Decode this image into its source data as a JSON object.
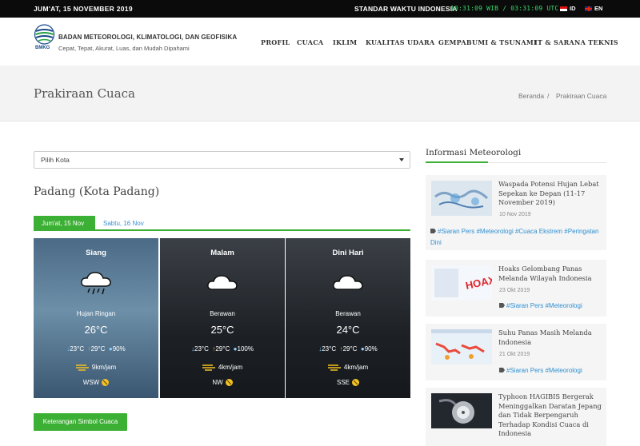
{
  "topbar": {
    "date": "JUM'AT, 15 NOVEMBER 2019",
    "standard_time_label": "STANDAR WAKTU INDONESIA",
    "clock": "10:31:09 WIB / 03:31:09 UTC",
    "lang_id": "ID",
    "lang_en": "EN"
  },
  "header": {
    "logo_text": "BMKG",
    "org_name": "BADAN METEOROLOGI, KLIMATOLOGI, DAN GEOFISIKA",
    "tagline": "Cepat, Tepat, Akurat, Luas, dan Mudah Dipahami",
    "nav": [
      "PROFIL",
      "CUACA",
      "IKLIM",
      "KUALITAS UDARA",
      "GEMPABUMI & TSUNAMI",
      "IT & SARANA TEKNIS"
    ]
  },
  "band": {
    "title": "Prakiraan Cuaca",
    "breadcrumb_home": "Beranda",
    "breadcrumb_sep": "/",
    "breadcrumb_current": "Prakiraan Cuaca"
  },
  "forecast": {
    "select_placeholder": "Pilih Kota",
    "city": "Padang (Kota Padang)",
    "tabs": [
      "Jum'at, 15 Nov",
      "Sabtu, 16 Nov"
    ],
    "cards": [
      {
        "period": "Siang",
        "weather": "Hujan Ringan",
        "temp": "26°C",
        "tmin": "23°C",
        "tmax": "29°C",
        "humidity": "90%",
        "wind_speed": "9km/jam",
        "wind_dir": "WSW"
      },
      {
        "period": "Malam",
        "weather": "Berawan",
        "temp": "25°C",
        "tmin": "23°C",
        "tmax": "29°C",
        "humidity": "100%",
        "wind_speed": "4km/jam",
        "wind_dir": "NW"
      },
      {
        "period": "Dini Hari",
        "weather": "Berawan",
        "temp": "24°C",
        "tmin": "23°C",
        "tmax": "29°C",
        "humidity": "90%",
        "wind_speed": "4km/jam",
        "wind_dir": "SSE"
      }
    ],
    "legend_button": "Keterangan Simbol Cuaca"
  },
  "sidebar": {
    "title": "Informasi Meteorologi",
    "news": [
      {
        "title": "Waspada Potensi Hujan Lebat Sepekan ke Depan (11-17 November 2019)",
        "date": "10 Nov 2019",
        "tags": "#Siaran Pers #Meteorologi #Cuaca Ekstrem #Peringatan Dini"
      },
      {
        "title": "Hoaks Gelombang Panas Melanda Wilayah Indonesia",
        "date": "23 Okt 2019",
        "tags": "#Siaran Pers #Meteorologi",
        "thumb_text": "HOAX"
      },
      {
        "title": "Suhu Panas Masih Melanda Indonesia",
        "date": "21 Okt 2019",
        "tags": "#Siaran Pers #Meteorologi"
      },
      {
        "title": "Typhoon HAGIBIS Bergerak Meninggalkan Daratan Jepang dan Tidak Berpengaruh Terhadap Kondisi Cuaca di Indonesia"
      }
    ]
  },
  "colors": {
    "accent_green": "#3cb034",
    "link_blue": "#2e8fd1",
    "clock_green": "#39d86a"
  }
}
